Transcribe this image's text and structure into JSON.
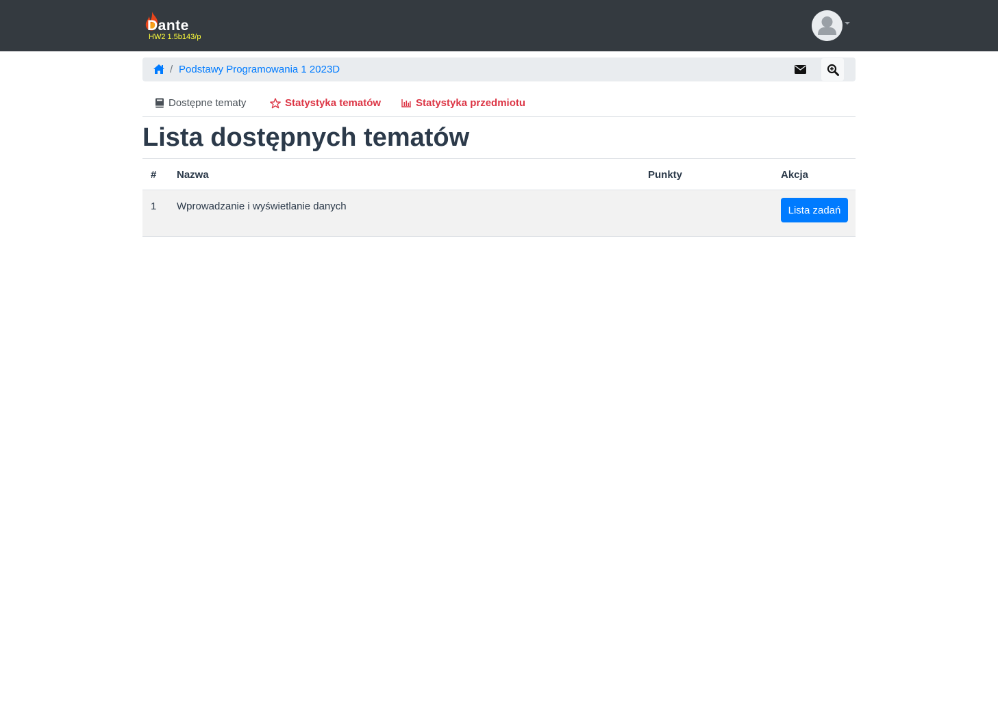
{
  "brand": {
    "name": "Dante",
    "version": "HW2 1.5b143/p"
  },
  "breadcrumb": {
    "separator": "/",
    "course": "Podstawy Programowania 1 2023D"
  },
  "tabs": [
    {
      "label": "Dostępne tematy",
      "icon": "book-icon",
      "active": true
    },
    {
      "label": "Statystyka tematów",
      "icon": "star-icon",
      "active": false
    },
    {
      "label": "Statystyka przedmiotu",
      "icon": "bar-chart-icon",
      "active": false
    }
  ],
  "page_title": "Lista dostępnych tematów",
  "table": {
    "headers": {
      "num": "#",
      "name": "Nazwa",
      "points": "Punkty",
      "action": "Akcja"
    },
    "rows": [
      {
        "num": "1",
        "name": "Wprowadzanie i wyświetlanie danych",
        "points": "",
        "action_label": "Lista zadań"
      }
    ]
  },
  "colors": {
    "navbar": "#343a40",
    "link": "#007bff",
    "danger_tab": "#dc3545",
    "primary_button": "#007bff"
  }
}
